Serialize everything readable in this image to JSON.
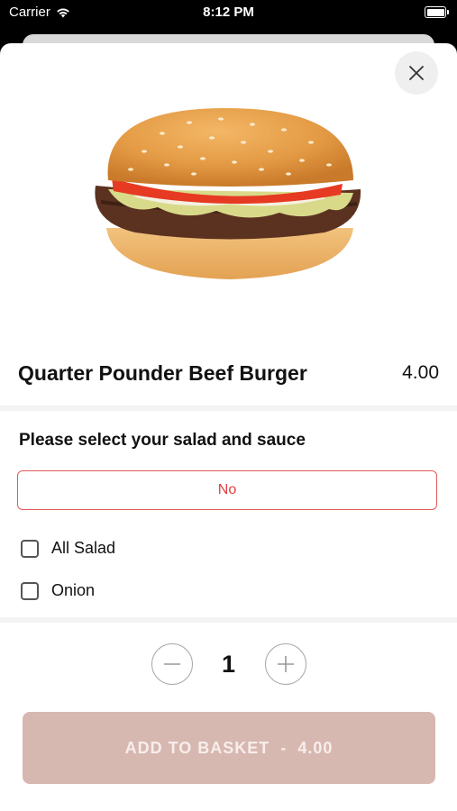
{
  "status_bar": {
    "carrier": "Carrier",
    "time": "8:12 PM",
    "wifi_icon": "wifi-icon",
    "battery_icon": "battery-icon"
  },
  "product": {
    "name": "Quarter Pounder Beef Burger",
    "price": "4.00",
    "image": "burger-image"
  },
  "options_section": {
    "heading": "Please select your salad and sauce",
    "selected_value": "No",
    "options": [
      {
        "label": "All Salad",
        "checked": false
      },
      {
        "label": "Onion",
        "checked": false
      }
    ]
  },
  "quantity": {
    "value": "1",
    "minus_icon": "minus-circle-icon",
    "plus_icon": "plus-circle-icon"
  },
  "add_button": {
    "label": "ADD TO BASKET",
    "separator": "-",
    "price": "4.00"
  },
  "colors": {
    "accent": "#e25a5a",
    "add_button_bg": "#d7b8b1"
  }
}
